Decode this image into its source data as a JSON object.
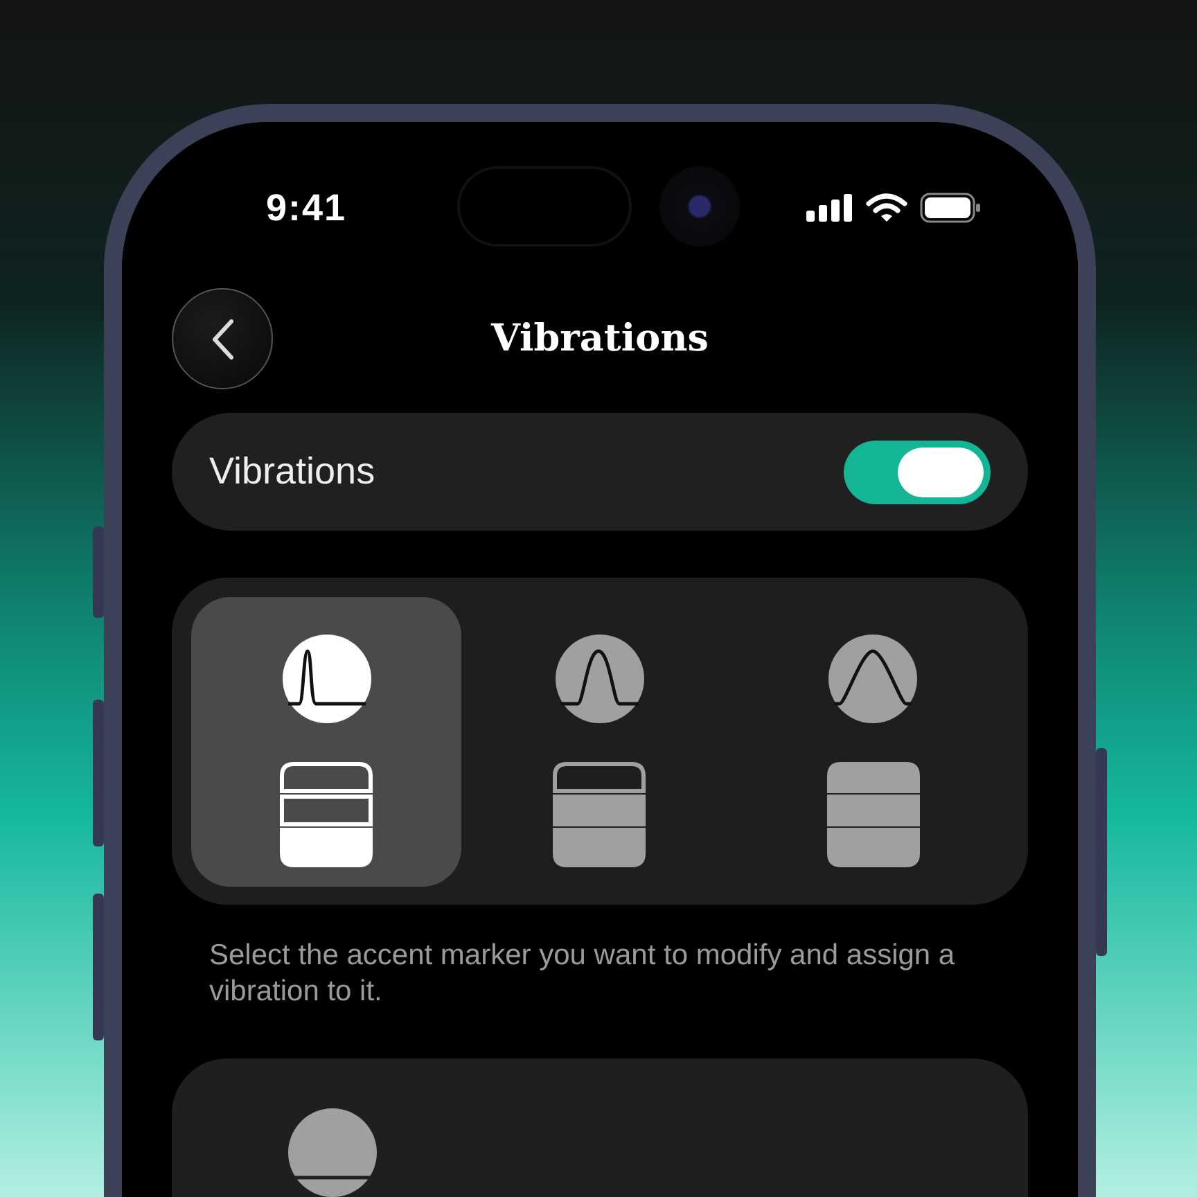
{
  "status_bar": {
    "time": "9:41"
  },
  "header": {
    "title": "Vibrations"
  },
  "toggle": {
    "label": "Vibrations",
    "on": true
  },
  "markers": [
    {
      "kind": "sharp",
      "selected": true,
      "bands": [
        {
          "filled": false
        },
        {
          "filled": false
        },
        {
          "filled": true
        }
      ]
    },
    {
      "kind": "medium",
      "selected": false,
      "bands": [
        {
          "filled": false
        },
        {
          "filled": true
        },
        {
          "filled": true
        }
      ]
    },
    {
      "kind": "wide",
      "selected": false,
      "bands": [
        {
          "filled": true
        },
        {
          "filled": true
        },
        {
          "filled": true
        }
      ]
    }
  ],
  "hint": "Select the accent marker you want to modify and assign a vibration to it."
}
